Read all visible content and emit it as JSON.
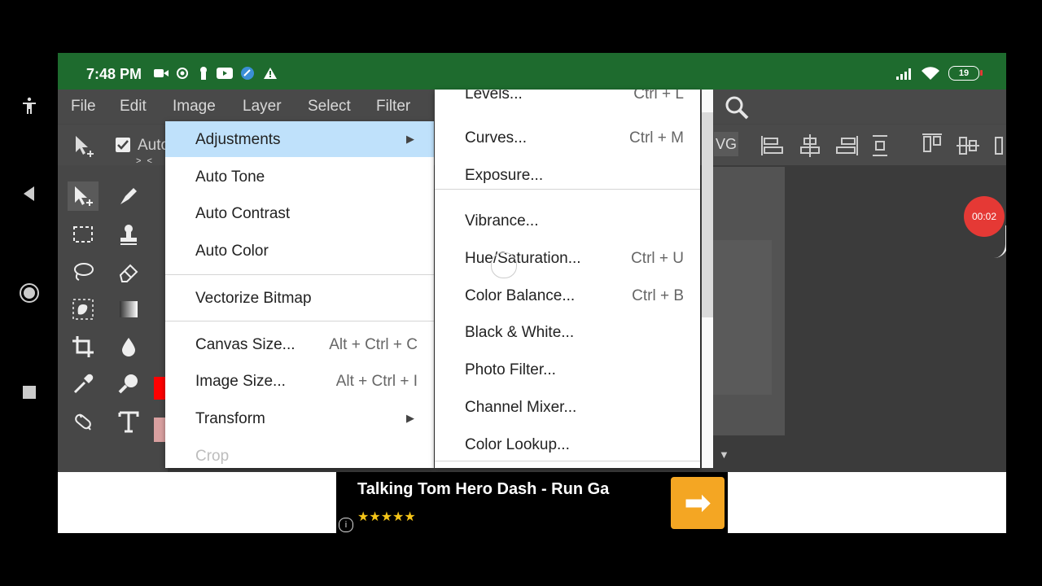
{
  "status": {
    "time": "7:48 PM",
    "battery": "19"
  },
  "menubar": {
    "items": [
      "File",
      "Edit",
      "Image",
      "Layer",
      "Select",
      "Filter"
    ]
  },
  "options": {
    "auto_label": "Auto",
    "svg_label": "VG",
    "collapse": "> <"
  },
  "image_menu": {
    "items": [
      {
        "label": "Adjustments",
        "shortcut": "",
        "submenu": true,
        "highlighted": true
      },
      {
        "label": "Auto Tone",
        "shortcut": ""
      },
      {
        "label": "Auto Contrast",
        "shortcut": ""
      },
      {
        "label": "Auto Color",
        "shortcut": ""
      },
      {
        "label": "Vectorize Bitmap",
        "shortcut": ""
      },
      {
        "label": "Canvas Size...",
        "shortcut": "Alt + Ctrl + C"
      },
      {
        "label": "Image Size...",
        "shortcut": "Alt + Ctrl + I"
      },
      {
        "label": "Transform",
        "shortcut": "",
        "submenu": true
      },
      {
        "label": "Crop",
        "shortcut": "",
        "disabled": true
      }
    ]
  },
  "adjustments_menu": {
    "items": [
      {
        "label": "Levels...",
        "shortcut": "Ctrl + L"
      },
      {
        "label": "Curves...",
        "shortcut": "Ctrl + M"
      },
      {
        "label": "Exposure...",
        "shortcut": ""
      },
      {
        "label": "Vibrance...",
        "shortcut": ""
      },
      {
        "label": "Hue/Saturation...",
        "shortcut": "Ctrl + U"
      },
      {
        "label": "Color Balance...",
        "shortcut": "Ctrl + B"
      },
      {
        "label": "Black & White...",
        "shortcut": ""
      },
      {
        "label": "Photo Filter...",
        "shortcut": ""
      },
      {
        "label": "Channel Mixer...",
        "shortcut": ""
      },
      {
        "label": "Color Lookup...",
        "shortcut": ""
      }
    ]
  },
  "recorder": {
    "time": "00:02"
  },
  "ad": {
    "title": "Talking Tom Hero Dash - Run Ga",
    "stars": "★★★★★",
    "arrow": "➡",
    "info": "i"
  },
  "colors": {
    "status_bar": "#1e6b2e",
    "highlight": "#bfe1fb",
    "foreground_swatch": "#ff0000",
    "background_swatch": "#d9a0a0",
    "record": "#e53935"
  }
}
